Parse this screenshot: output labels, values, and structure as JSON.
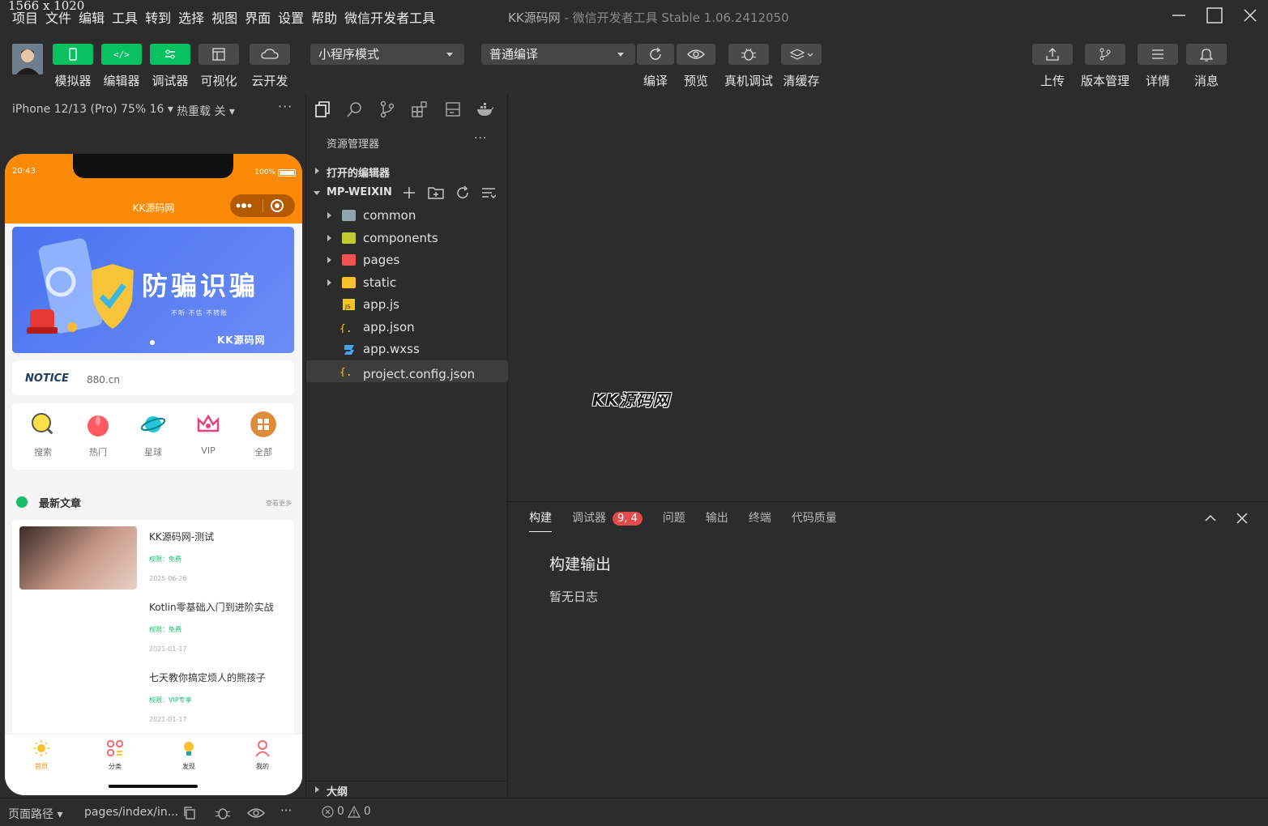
{
  "dim_label": "1566 x 1020",
  "menu": [
    "项目",
    "文件",
    "编辑",
    "工具",
    "转到",
    "选择",
    "视图",
    "界面",
    "设置",
    "帮助",
    "微信开发者工具"
  ],
  "window_title": {
    "app": "KK源码网",
    "rest": " - 微信开发者工具 Stable 1.06.2412050"
  },
  "toolbar": {
    "left_buttons": [
      "模拟器",
      "编辑器",
      "调试器",
      "可视化",
      "云开发"
    ],
    "mode_select": "小程序模式",
    "compile_select": "普通编译",
    "mid_buttons": [
      "编译",
      "预览",
      "真机调试",
      "清缓存"
    ],
    "right_buttons": [
      "上传",
      "版本管理",
      "详情",
      "消息"
    ]
  },
  "simulator": {
    "device": "iPhone 12/13 (Pro) 75% 16",
    "hot_reload": "热重载 关",
    "more": "···",
    "status_time": "20:43",
    "battery": "100%",
    "nav_title": "KK源码网",
    "banner": {
      "title": "防骗识骗",
      "subtitle": "不听·不信·不转账",
      "brand": "KK源码网"
    },
    "notice": {
      "tag": "NOTICE",
      "text": "880.cn"
    },
    "grid": [
      "搜索",
      "热门",
      "星球",
      "VIP",
      "全部"
    ],
    "section": {
      "title": "最新文章",
      "more": "查看更多"
    },
    "articles": [
      {
        "title": "KK源码网-测试",
        "perm": "权限：免费",
        "date": "2025-06-26"
      },
      {
        "title": "Kotlin零基础入门到进阶实战",
        "perm": "权限：免费",
        "date": "2021-01-17"
      },
      {
        "title": "七天教你搞定烦人的熊孩子",
        "perm": "权限：VIP专享",
        "date": "2021-01-17"
      }
    ],
    "tabs": [
      "首页",
      "分类",
      "发现",
      "我的"
    ],
    "bottom": {
      "page_path": "页面路径",
      "path": "pages/index/in..."
    }
  },
  "explorer": {
    "title": "资源管理器",
    "more": "···",
    "open_editors": "打开的编辑器",
    "project": "MP-WEIXIN",
    "items": [
      {
        "name": "common",
        "type": "folder",
        "color": "#90a4ae"
      },
      {
        "name": "components",
        "type": "folder",
        "color": "#c0ca33"
      },
      {
        "name": "pages",
        "type": "folder",
        "color": "#ef5350"
      },
      {
        "name": "static",
        "type": "folder",
        "color": "#fbc02d"
      },
      {
        "name": "app.js",
        "type": "js",
        "color": "#f5c518"
      },
      {
        "name": "app.json",
        "type": "json",
        "color": "#f5c518"
      },
      {
        "name": "app.wxss",
        "type": "wxss",
        "color": "#42a5f5"
      },
      {
        "name": "project.config.json",
        "type": "json",
        "color": "#f5c518"
      }
    ],
    "outline": "大纲"
  },
  "editor": {
    "watermark": "KK源码网"
  },
  "panel": {
    "tabs": [
      "构建",
      "调试器",
      "问题",
      "输出",
      "终端",
      "代码质量"
    ],
    "debugger_badge": "9, 4",
    "output_title": "构建输出",
    "output_body": "暂无日志"
  },
  "status": {
    "errors": "0",
    "warnings": "0"
  },
  "colors": {
    "accent_green": "#07c160",
    "phone_orange": "#fb8a08",
    "badge_red": "#e24b4b"
  }
}
